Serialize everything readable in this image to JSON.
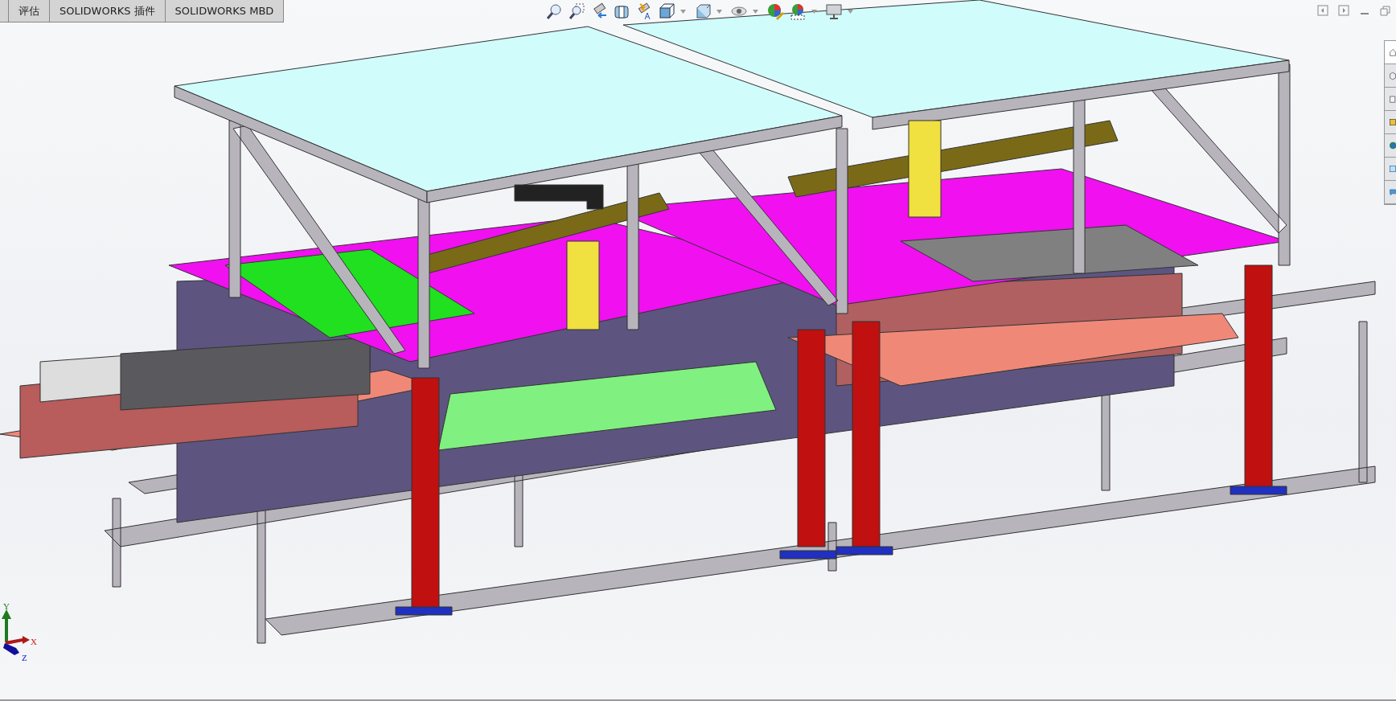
{
  "tabs": [
    {
      "label": "评估",
      "selected": false
    },
    {
      "label": "SOLIDWORKS 插件",
      "selected": false
    },
    {
      "label": "SOLIDWORKS MBD",
      "selected": false
    }
  ],
  "task_pane_tabs": [
    {
      "selected": true
    },
    {
      "selected": false
    },
    {
      "selected": false
    },
    {
      "selected": false
    },
    {
      "selected": false
    },
    {
      "selected": false
    },
    {
      "selected": false
    }
  ],
  "triad": {
    "x": "X",
    "y": "Y",
    "z": "Z"
  }
}
